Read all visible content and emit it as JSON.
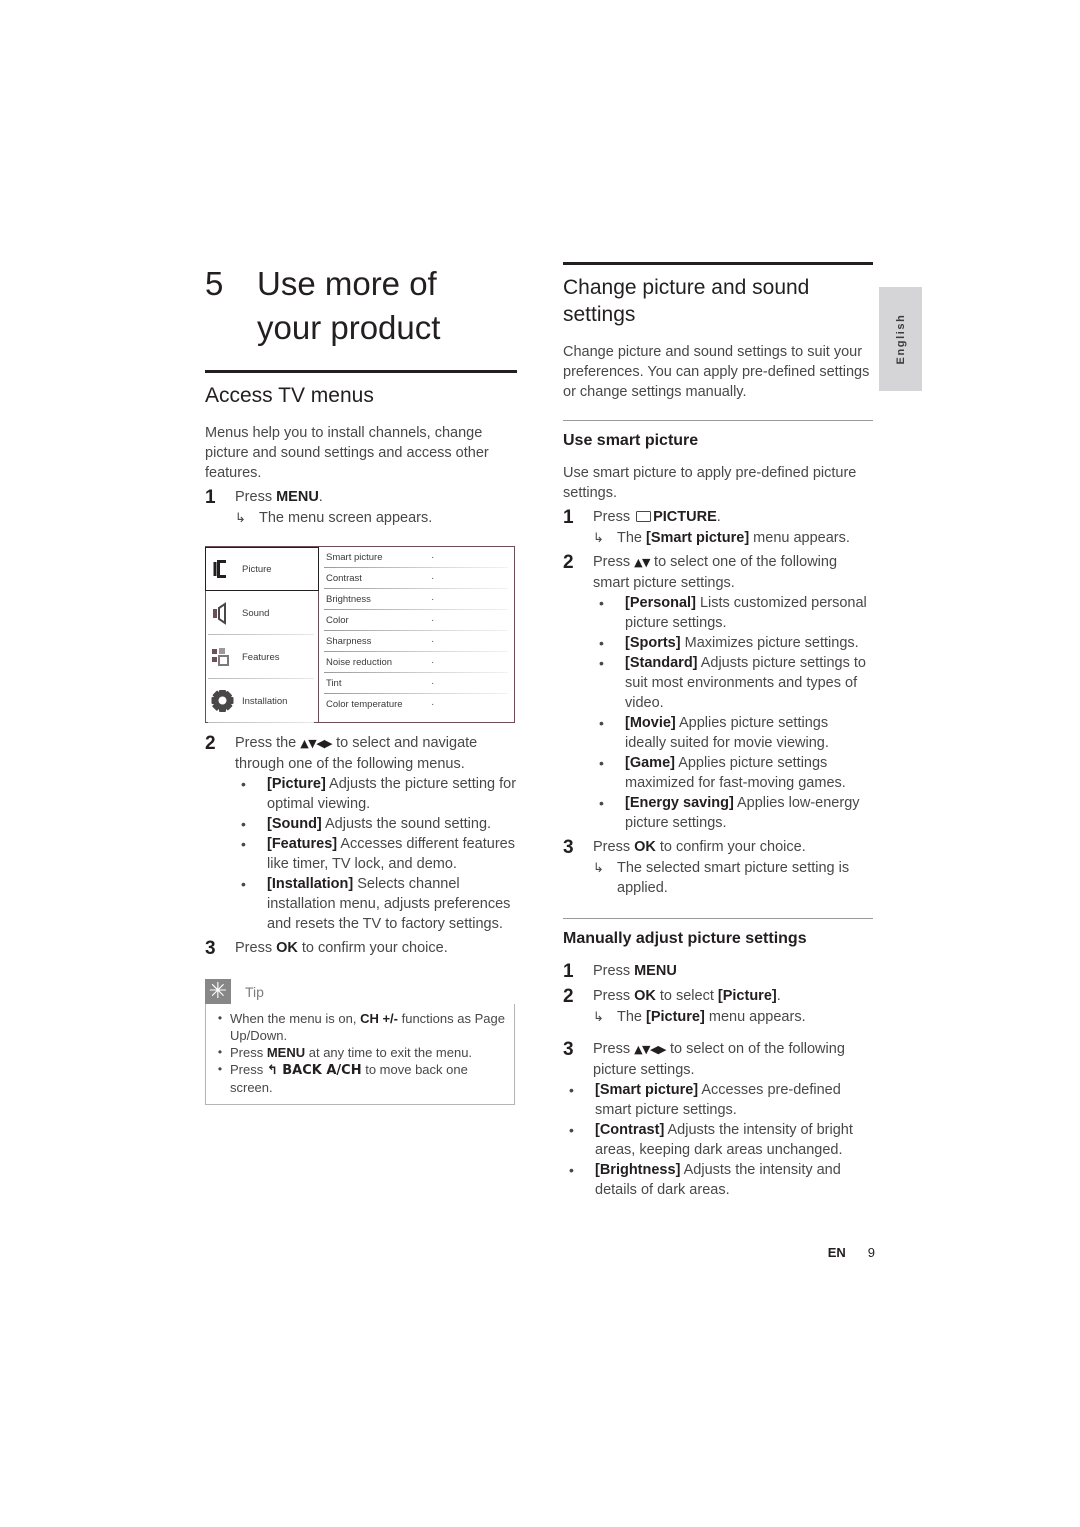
{
  "document": {
    "language_tab": "English",
    "footer": {
      "lang_code": "EN",
      "page_number": "9"
    }
  },
  "left_column": {
    "chapter": {
      "number": "5",
      "title_line1": "Use more of",
      "title_line2": "your product"
    },
    "section_title": "Access TV menus",
    "intro": "Menus help you to install channels, change picture and sound settings and access other features.",
    "step1": {
      "num": "1",
      "text_before": "Press ",
      "text_bold": "MENU",
      "text_after": ".",
      "result": "The menu screen appears.",
      "arrow": "↳"
    },
    "figure": {
      "menu_items": [
        {
          "label": "Picture",
          "icon": "picture-icon",
          "selected": true
        },
        {
          "label": "Sound",
          "icon": "speaker-icon",
          "selected": false
        },
        {
          "label": "Features",
          "icon": "features-icon",
          "selected": false
        },
        {
          "label": "Installation",
          "icon": "gear-icon",
          "selected": false
        }
      ],
      "settings": [
        {
          "label": "Smart picture",
          "value": "·"
        },
        {
          "label": "Contrast",
          "value": "·"
        },
        {
          "label": "Brightness",
          "value": "·"
        },
        {
          "label": "Color",
          "value": "·"
        },
        {
          "label": "Sharpness",
          "value": "·"
        },
        {
          "label": "Noise reduction",
          "value": "·"
        },
        {
          "label": "Tint",
          "value": "·"
        },
        {
          "label": "Color temperature",
          "value": "·"
        }
      ]
    },
    "step2": {
      "num": "2",
      "lead_before": "Press the ",
      "lead_keys": "▲▼◀▶",
      "lead_after": " to select and navigate through one of the following menus.",
      "bullets": [
        {
          "bold": "[Picture]",
          "rest": " Adjusts the picture setting for optimal viewing."
        },
        {
          "bold": "[Sound]",
          "rest": " Adjusts the sound setting."
        },
        {
          "bold": "[Features]",
          "rest": " Accesses different features like timer, TV lock, and demo."
        },
        {
          "bold": "[Installation]",
          "rest": " Selects channel installation menu, adjusts preferences and resets the TV to factory settings."
        }
      ]
    },
    "step3": {
      "num": "3",
      "text_before": "Press ",
      "text_bold": "OK",
      "text_after": " to confirm your choice."
    },
    "tip": {
      "title": "Tip",
      "icon": "asterisk-icon",
      "items": [
        {
          "pre": "When the menu is on, ",
          "bold": "CH +/-",
          "post": " functions as Page Up/Down."
        },
        {
          "pre": "Press ",
          "bold": "MENU",
          "post": " at any time to exit the menu."
        },
        {
          "pre": "Press ",
          "bold": "↰ BACK A/CH",
          "post": " to move back one screen."
        }
      ]
    }
  },
  "right_column": {
    "section_title_line1": "Change picture and sound",
    "section_title_line2": "settings",
    "intro": "Change picture and sound settings to suit your preferences. You can apply pre-defined settings or change settings manually.",
    "subsection1": {
      "title": "Use smart picture",
      "intro": "Use smart picture to apply pre-defined picture settings.",
      "step1": {
        "num": "1",
        "text_before": "Press ",
        "icon": "picture-button-icon",
        "text_bold": "PICTURE",
        "text_after": ".",
        "arrow": "↳",
        "result_pre": "The ",
        "result_bold": "[Smart picture]",
        "result_post": " menu appears."
      },
      "step2": {
        "num": "2",
        "lead_before": "Press ",
        "lead_keys": "▲▼",
        "lead_after": " to select one of the following smart picture settings.",
        "bullets": [
          {
            "bold": "[Personal]",
            "rest": " Lists customized personal picture settings."
          },
          {
            "bold": "[Sports]",
            "rest": " Maximizes picture settings."
          },
          {
            "bold": "[Standard]",
            "rest": " Adjusts picture settings to suit most environments and types of video."
          },
          {
            "bold": "[Movie]",
            "rest": " Applies picture settings ideally suited for movie viewing."
          },
          {
            "bold": "[Game]",
            "rest": " Applies picture settings maximized for fast-moving games."
          },
          {
            "bold": "[Energy saving]",
            "rest": " Applies low-energy picture settings."
          }
        ]
      },
      "step3": {
        "num": "3",
        "text_before": "Press ",
        "text_bold": "OK",
        "text_after": " to confirm your choice.",
        "arrow": "↳",
        "result": "The selected smart picture setting is applied."
      }
    },
    "subsection2": {
      "title": "Manually adjust picture settings",
      "step1": {
        "num": "1",
        "text_before": "Press ",
        "text_bold": "MENU",
        "text_after": ""
      },
      "step2": {
        "num": "2",
        "text_before": "Press ",
        "text_bold": "OK",
        "text_mid": " to select ",
        "text_bold2": "[Picture]",
        "text_after": ".",
        "arrow": "↳",
        "result_pre": "The ",
        "result_bold": "[Picture]",
        "result_post": " menu appears."
      },
      "step3": {
        "num": "3",
        "lead_before": "Press ",
        "lead_keys": "▲▼◀▶",
        "lead_after": " to select on of the following picture settings."
      },
      "bullets": [
        {
          "bold": "[Smart picture]",
          "rest": " Accesses pre-defined smart picture settings."
        },
        {
          "bold": "[Contrast]",
          "rest": " Adjusts the intensity of bright areas, keeping dark areas unchanged."
        },
        {
          "bold": "[Brightness]",
          "rest": " Adjusts the intensity and details of dark areas."
        }
      ]
    }
  }
}
